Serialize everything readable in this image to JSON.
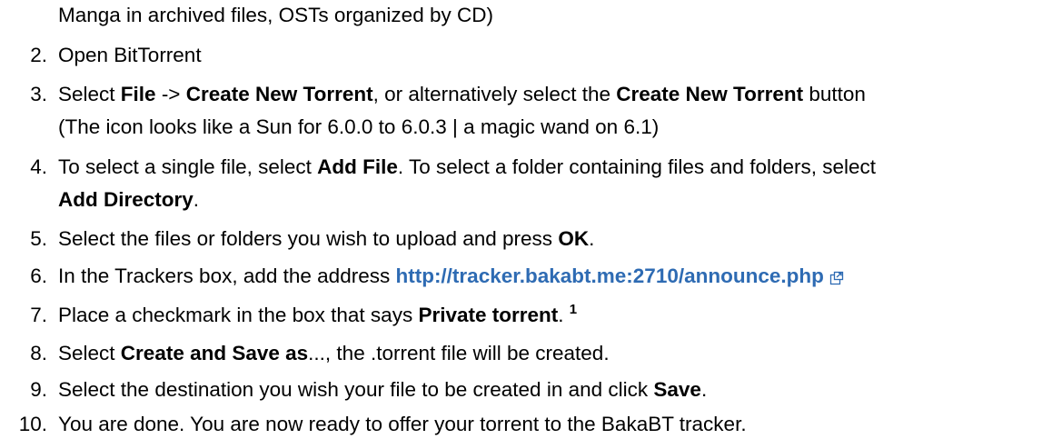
{
  "intro_continuation": "Manga in archived files, OSTs organized by CD)",
  "steps": [
    {
      "number": "2.",
      "text": "Open BitTorrent"
    },
    {
      "number": "3.",
      "t1": "Select ",
      "b1": "File",
      "t2": " -> ",
      "b2": "Create New Torrent",
      "t3": ", or alternatively select the ",
      "b3": "Create New Torrent",
      "t4": " button",
      "line2": "(The icon looks like a Sun for 6.0.0 to 6.0.3 | a magic wand on 6.1)"
    },
    {
      "number": "4.",
      "t1": "To select a single file, select ",
      "b1": "Add File",
      "t2": ". To select a folder containing files and folders, select",
      "b2": "Add Directory",
      "t3": "."
    },
    {
      "number": "5.",
      "t1": "Select the files or folders you wish to upload and press ",
      "b1": "OK",
      "t2": "."
    },
    {
      "number": "6.",
      "t1": "In the Trackers box, add the address ",
      "link": "http://tracker.bakabt.me:2710/announce.php"
    },
    {
      "number": "7.",
      "t1": "Place a checkmark in the box that says ",
      "b1": "Private torrent",
      "t2": ". ",
      "sup": "1"
    },
    {
      "number": "8.",
      "t1": "Select ",
      "b1": "Create and Save as",
      "t2": "..., the .torrent file will be created."
    },
    {
      "number": "9.",
      "t1": "Select the destination you wish your file to be created in and click ",
      "b1": "Save",
      "t2": "."
    },
    {
      "number": "10.",
      "t1": "You are done. You are now ready to offer your torrent to the BakaBT tracker."
    }
  ],
  "icons": {
    "external_link": "external-link-icon"
  },
  "colors": {
    "link": "#2e6bb3",
    "text": "#000000"
  }
}
